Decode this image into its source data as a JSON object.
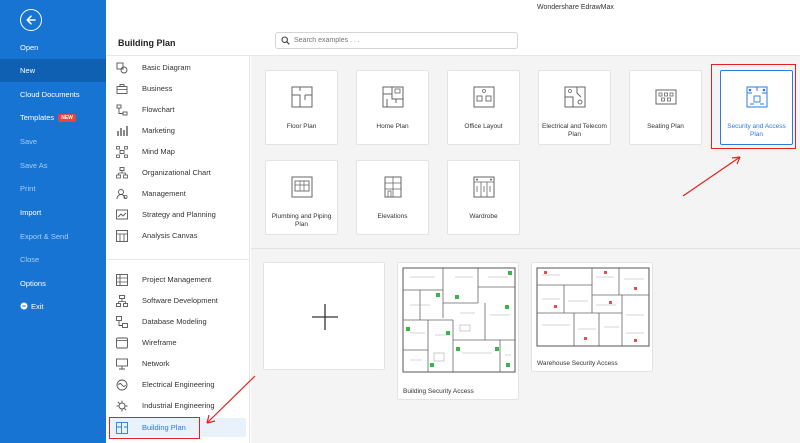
{
  "app": {
    "title": "Wondershare EdrawMax"
  },
  "header": {
    "page_title": "Building Plan",
    "search_placeholder": "Search examples . . ."
  },
  "leftnav": {
    "items": [
      {
        "label": "Open",
        "dim": false
      },
      {
        "label": "New",
        "dim": false
      },
      {
        "label": "Cloud Documents",
        "dim": false
      },
      {
        "label": "Templates",
        "dim": false,
        "badge": "NEW"
      },
      {
        "label": "Save",
        "dim": true
      },
      {
        "label": "Save As",
        "dim": true
      },
      {
        "label": "Print",
        "dim": true
      },
      {
        "label": "Import",
        "dim": false
      },
      {
        "label": "Export & Send",
        "dim": true
      },
      {
        "label": "Close",
        "dim": true
      },
      {
        "label": "Options",
        "dim": false
      },
      {
        "label": "Exit",
        "dim": false
      }
    ]
  },
  "categories": {
    "group1": [
      {
        "label": "Basic Diagram",
        "icon": "shapes-icon"
      },
      {
        "label": "Business",
        "icon": "briefcase-icon"
      },
      {
        "label": "Flowchart",
        "icon": "flowchart-icon"
      },
      {
        "label": "Marketing",
        "icon": "bar-chart-icon"
      },
      {
        "label": "Mind Map",
        "icon": "mind-map-icon"
      },
      {
        "label": "Organizational Chart",
        "icon": "org-chart-icon"
      },
      {
        "label": "Management",
        "icon": "management-icon"
      },
      {
        "label": "Strategy and Planning",
        "icon": "strategy-icon"
      },
      {
        "label": "Analysis Canvas",
        "icon": "canvas-icon"
      }
    ],
    "group2": [
      {
        "label": "Project Management",
        "icon": "project-icon"
      },
      {
        "label": "Software Development",
        "icon": "software-icon"
      },
      {
        "label": "Database Modeling",
        "icon": "database-icon"
      },
      {
        "label": "Wireframe",
        "icon": "wireframe-icon"
      },
      {
        "label": "Network",
        "icon": "network-icon"
      },
      {
        "label": "Electrical Engineering",
        "icon": "electrical-icon"
      },
      {
        "label": "Industrial Engineering",
        "icon": "industrial-icon"
      },
      {
        "label": "Building Plan",
        "icon": "building-plan-icon"
      }
    ]
  },
  "templates": [
    {
      "label": "Floor Plan",
      "icon": "floor-plan-icon"
    },
    {
      "label": "Home Plan",
      "icon": "home-plan-icon"
    },
    {
      "label": "Office Layout",
      "icon": "office-layout-icon"
    },
    {
      "label": "Electrical and Telecom Plan",
      "icon": "electrical-plan-icon"
    },
    {
      "label": "Seating Plan",
      "icon": "seating-plan-icon"
    },
    {
      "label": "Security and Access Plan",
      "icon": "security-plan-icon"
    },
    {
      "label": "Plumbing and Piping Plan",
      "icon": "plumbing-icon"
    },
    {
      "label": "Elevations",
      "icon": "elevations-icon"
    },
    {
      "label": "Wardrobe",
      "icon": "wardrobe-icon"
    }
  ],
  "examples": [
    {
      "label": "Building Security Access"
    },
    {
      "label": "Warehouse Security Access"
    }
  ],
  "colors": {
    "nav_bg": "#1874d2",
    "accent": "#2a7ae2",
    "highlight": "#e52020"
  }
}
